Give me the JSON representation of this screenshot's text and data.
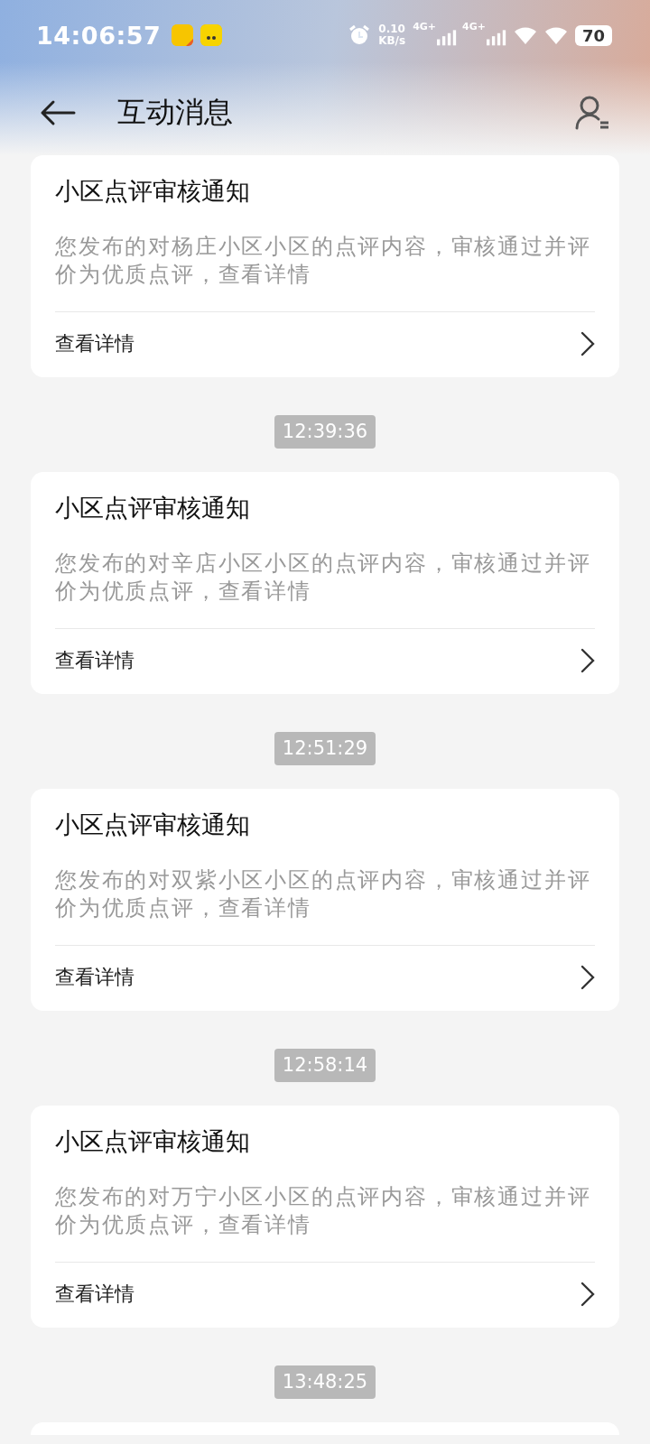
{
  "status_bar": {
    "time": "14:06:57",
    "net_speed": "0.10",
    "net_unit": "KB/s",
    "signal_labels": [
      "4G+",
      "4G+"
    ],
    "battery": "70"
  },
  "header": {
    "title": "互动消息"
  },
  "feed": [
    {
      "kind": "card",
      "title": "小区点评审核通知",
      "body": "您发布的对杨庄小区小区的点评内容，审核通过并评价为优质点评，查看详情",
      "action": "查看详情"
    },
    {
      "kind": "time",
      "text": "12:39:36"
    },
    {
      "kind": "card",
      "title": "小区点评审核通知",
      "body": "您发布的对辛店小区小区的点评内容，审核通过并评价为优质点评，查看详情",
      "action": "查看详情"
    },
    {
      "kind": "time",
      "text": "12:51:29"
    },
    {
      "kind": "card",
      "title": "小区点评审核通知",
      "body": "您发布的对双紫小区小区的点评内容，审核通过并评价为优质点评，查看详情",
      "action": "查看详情"
    },
    {
      "kind": "time",
      "text": "12:58:14"
    },
    {
      "kind": "card",
      "title": "小区点评审核通知",
      "body": "您发布的对万宁小区小区的点评内容，审核通过并评价为优质点评，查看详情",
      "action": "查看详情"
    },
    {
      "kind": "time",
      "text": "13:48:25"
    },
    {
      "kind": "partial"
    }
  ]
}
